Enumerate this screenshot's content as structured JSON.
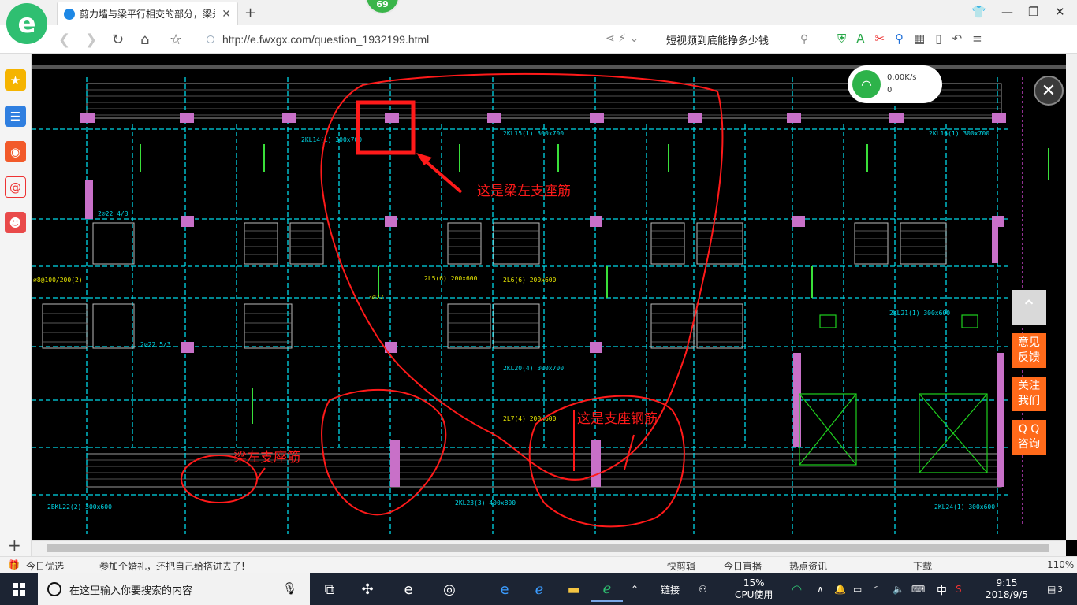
{
  "browser": {
    "tab_title": "剪力墙与梁平行相交的部分，梁是",
    "badge": "69",
    "url": "http://e.fwxgx.com/question_1932199.html",
    "search_text": "短视频到底能挣多少钱",
    "logo_letter": "e"
  },
  "speed_widget": {
    "rate": "0.00K/s",
    "count": "0"
  },
  "annotations": {
    "top": "这是梁左支座筋",
    "right": "这是支座钢筋",
    "left": "梁左支座筋"
  },
  "cad_labels": {
    "kl14": "2KL14(1) 300x700",
    "kl15": "2KL15(1) 300x700",
    "kl16": "2KL16(1) 300x700",
    "kl20": "2KL20(4) 300x700",
    "kl21": "2KL21(1) 300x600",
    "kl22": "2BKL22(2) 300x600",
    "kl23": "2KL23(3) 400x800",
    "kl24": "2KL24(1) 300x600",
    "l5": "2L5(6) 200x600",
    "l6": "2L6(6) 200x600",
    "l7": "2L7(4) 200x600",
    "r1": "2⌀22 4/3",
    "r2": "3⌀22",
    "r3": "⌀8@100/200(2)",
    "r4": "2⌀22 5/3"
  },
  "right_buttons": {
    "feedback": "意见\n反馈",
    "follow": "关注\n我们",
    "qq": "Q Q\n咨询"
  },
  "statusbar": {
    "today": "今日优选",
    "news": "参加个婚礼，还把自己给搭进去了!",
    "clip": "快剪辑",
    "live": "今日直播",
    "hot": "热点资讯",
    "download": "下载",
    "zoom": "110%"
  },
  "taskbar": {
    "search_placeholder": "在这里输入你要搜索的内容",
    "link": "链接",
    "cpu_percent": "15%",
    "cpu_label": "CPU使用",
    "ime": "中",
    "time": "9:15",
    "date": "2018/9/5",
    "notif_count": "3"
  },
  "colors": {
    "accent_green": "#2fbf71",
    "orange_button": "#ff6a1a",
    "cad_red": "#ff1a1a",
    "cad_cyan": "#00d8e8",
    "cad_magenta": "#e060e0",
    "cad_yellow": "#e8e800"
  }
}
